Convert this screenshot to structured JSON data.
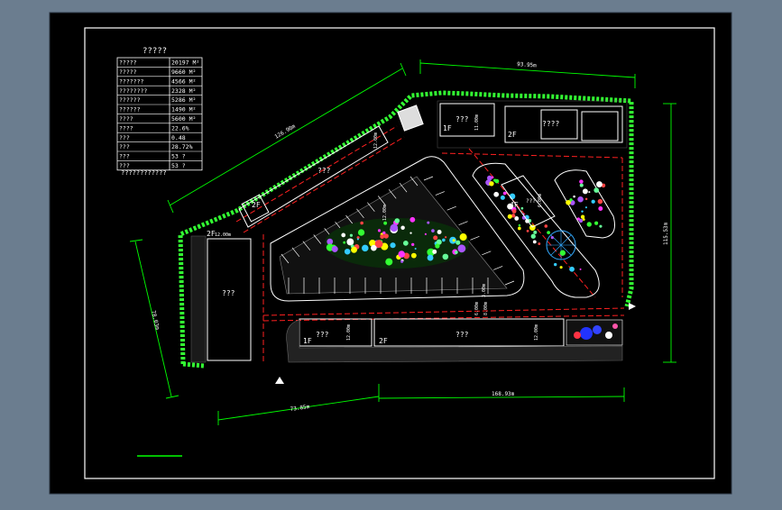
{
  "colors": {
    "window": "#6b7d8f",
    "canvas": "#000000",
    "frame": "#ffffff",
    "dim": "#00ff00",
    "road": "#ff2020",
    "building": "#ffffff",
    "hedge": "#33ff33",
    "planting": "#ffff00"
  },
  "table": {
    "title": "?????",
    "rows": [
      {
        "label": "?????",
        "value": "20197 M²"
      },
      {
        "label": "?????",
        "value": "9660 M²"
      },
      {
        "label": "???????",
        "value": "4566 M²"
      },
      {
        "label": "????????",
        "value": "2328 M²"
      },
      {
        "label": "??????",
        "value": "5286 M²"
      },
      {
        "label": "??????",
        "value": "1490 M²"
      },
      {
        "label": "????",
        "value": "5600 M²"
      },
      {
        "label": "????",
        "value": "22.6%"
      },
      {
        "label": "???",
        "value": "0.48"
      },
      {
        "label": "???",
        "value": "28.72%"
      },
      {
        "label": "???",
        "value": "53 ?"
      },
      {
        "label": "???",
        "value": "53 ?"
      }
    ],
    "note": "????????????"
  },
  "dimensions": {
    "top": "93.95m",
    "northwest": "126.90m",
    "east": "115.53m",
    "west": "78.03m",
    "bottom_left": "73.85m",
    "bottom_right": "168.93m"
  },
  "buildings": {
    "b_top_1": {
      "floors": "1F",
      "name": "???",
      "width": "11.00m"
    },
    "b_top_2": {
      "floors": "2F",
      "name": "????"
    },
    "b_diag": {
      "name": "???",
      "width": "12.00m"
    },
    "b_corner": {
      "floors": "2F"
    },
    "b_west": {
      "floors": "2F",
      "name": "???",
      "width": "12.00m"
    },
    "b_center": {
      "floors": "4F",
      "name": "???"
    },
    "b_south_1": {
      "floors": "1F",
      "name": "???",
      "width": "12.00m"
    },
    "b_south_2": {
      "floors": "2F",
      "name": "???",
      "width": "12.00m"
    }
  },
  "road_labels": [
    "6.00m",
    "8.00m",
    "3.00m",
    "12.00m",
    "6.00m"
  ]
}
